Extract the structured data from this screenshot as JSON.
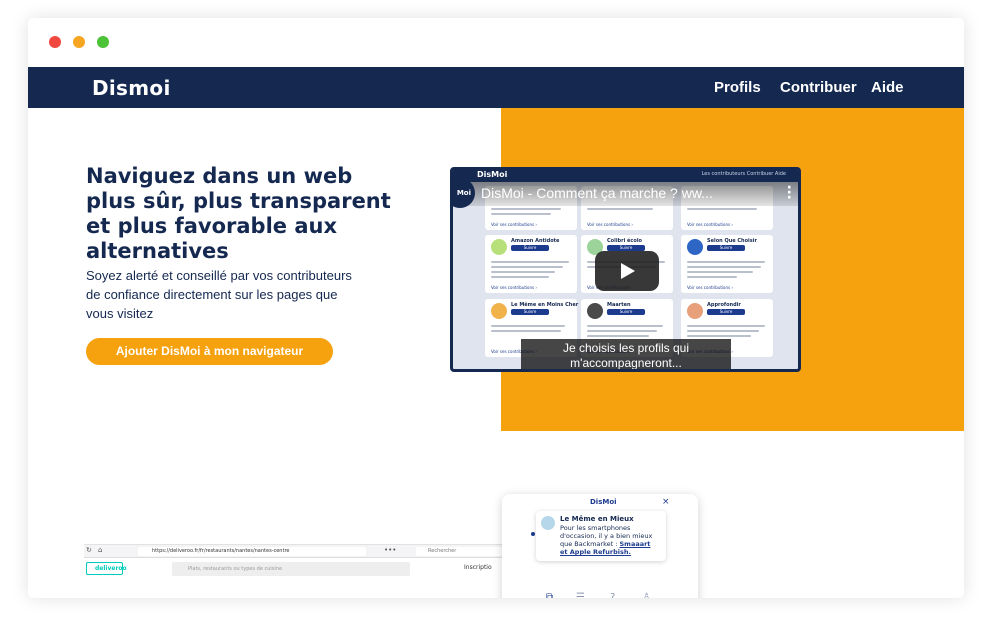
{
  "window": {
    "controls": [
      "close",
      "minimize",
      "maximize"
    ]
  },
  "navbar": {
    "logo": "Dismoi",
    "links": [
      "Profils",
      "Contribuer",
      "Aide"
    ]
  },
  "hero": {
    "headline": "Naviguez dans un web plus sûr, plus transparent et plus favorable aux alternatives",
    "subtext": "Soyez alerté et conseillé par vos contributeurs de confiance directement sur les pages que vous visitez",
    "cta_label": "Ajouter DisMoi à mon navigateur"
  },
  "video": {
    "title": "DisMoi - Comment ça marche ? ww...",
    "caption": "Je choisis les profils qui m'accompagneront...",
    "brand": "DisMoi",
    "avatar_label": "Moi",
    "header_links": "Les contributeurs   Contribuer   Aide",
    "card_link": "Voir ses contributions ›",
    "follow_label": "Suivre",
    "cards": [
      {
        "name": "Amazon Antidote"
      },
      {
        "name": "Colibri écolo"
      },
      {
        "name": "Selon Que Choisir"
      },
      {
        "name": "Le Même en Moins Cher"
      },
      {
        "name": "Maarten"
      },
      {
        "name": "Approfondir"
      }
    ]
  },
  "browser": {
    "url": "https://deliveroo.fr/fr/restaurants/nantes/nantes-centre",
    "search_placeholder": "Rechercher",
    "logo": "deliveroo",
    "site_search_placeholder": "Plats, restaurants ou types de cuisine",
    "signup": "Inscriptio"
  },
  "popup": {
    "title": "DisMoi",
    "close": "×",
    "author": "Le Même en Mieux",
    "message_prefix": "Pour les smartphones d'occasion, il y a bien mieux que Backmarket : ",
    "message_link": "Smaaart et Apple Refurbish."
  },
  "colors": {
    "navy": "#142850",
    "orange": "#f6a10e",
    "accent_blue": "#1d3b8e"
  }
}
